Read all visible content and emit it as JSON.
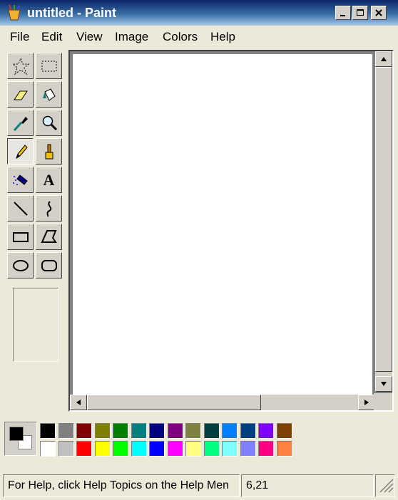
{
  "window": {
    "title": "untitled - Paint",
    "app_icon": "paint-brush-cup-icon"
  },
  "menu": [
    "File",
    "Edit",
    "View",
    "Image",
    "Colors",
    "Help"
  ],
  "tools": [
    {
      "name": "free-form-select",
      "icon": "star-select-icon"
    },
    {
      "name": "select",
      "icon": "rect-select-icon"
    },
    {
      "name": "eraser",
      "icon": "eraser-icon"
    },
    {
      "name": "fill-with-color",
      "icon": "paint-bucket-icon"
    },
    {
      "name": "pick-color",
      "icon": "eyedropper-icon"
    },
    {
      "name": "magnifier",
      "icon": "magnifier-icon"
    },
    {
      "name": "pencil",
      "icon": "pencil-icon",
      "active": true
    },
    {
      "name": "brush",
      "icon": "brush-icon"
    },
    {
      "name": "airbrush",
      "icon": "airbrush-icon"
    },
    {
      "name": "text",
      "icon": "text-icon",
      "glyph": "A"
    },
    {
      "name": "line",
      "icon": "line-icon"
    },
    {
      "name": "curve",
      "icon": "curve-icon"
    },
    {
      "name": "rectangle",
      "icon": "rectangle-icon"
    },
    {
      "name": "polygon",
      "icon": "polygon-icon"
    },
    {
      "name": "ellipse",
      "icon": "ellipse-icon"
    },
    {
      "name": "rounded-rectangle",
      "icon": "rounded-rect-icon"
    }
  ],
  "palette": {
    "foreground": "#000000",
    "background": "#ffffff",
    "row1": [
      "#000000",
      "#808080",
      "#800000",
      "#808000",
      "#008000",
      "#008080",
      "#000080",
      "#800080",
      "#808040",
      "#004040",
      "#0080ff",
      "#004080",
      "#8000ff",
      "#804000"
    ],
    "row2": [
      "#ffffff",
      "#c0c0c0",
      "#ff0000",
      "#ffff00",
      "#00ff00",
      "#00ffff",
      "#0000ff",
      "#ff00ff",
      "#ffff80",
      "#00ff80",
      "#80ffff",
      "#8080ff",
      "#ff0080",
      "#ff8040"
    ]
  },
  "status": {
    "help_text": "For Help, click Help Topics on the Help Men",
    "coords": "6,21"
  }
}
